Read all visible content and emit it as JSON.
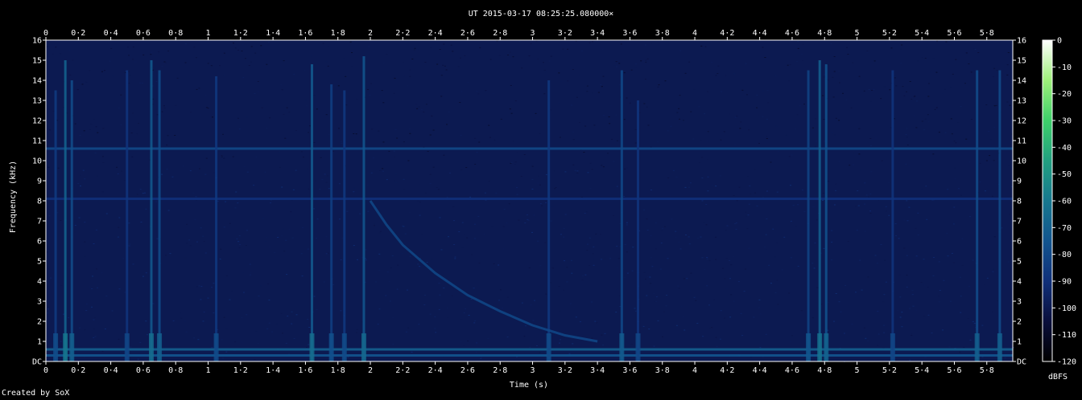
{
  "chart_data": {
    "type": "heatmap",
    "title": "UT 2015-03-17 08:25:25.080000×",
    "xlabel": "Time (s)",
    "ylabel": "Frequency (kHz)",
    "colorbar_label": "dBFS",
    "credit": "Created by SoX",
    "xlim": [
      0,
      5.96
    ],
    "ylim": [
      0,
      16
    ],
    "x_ticks": [
      {
        "v": 0,
        "label": "0"
      },
      {
        "v": 0.2,
        "label": "0·2"
      },
      {
        "v": 0.4,
        "label": "0·4"
      },
      {
        "v": 0.6,
        "label": "0·6"
      },
      {
        "v": 0.8,
        "label": "0·8"
      },
      {
        "v": 1,
        "label": "1"
      },
      {
        "v": 1.2,
        "label": "1·2"
      },
      {
        "v": 1.4,
        "label": "1·4"
      },
      {
        "v": 1.6,
        "label": "1·6"
      },
      {
        "v": 1.8,
        "label": "1·8"
      },
      {
        "v": 2,
        "label": "2"
      },
      {
        "v": 2.2,
        "label": "2·2"
      },
      {
        "v": 2.4,
        "label": "2·4"
      },
      {
        "v": 2.6,
        "label": "2·6"
      },
      {
        "v": 2.8,
        "label": "2·8"
      },
      {
        "v": 3,
        "label": "3"
      },
      {
        "v": 3.2,
        "label": "3·2"
      },
      {
        "v": 3.4,
        "label": "3·4"
      },
      {
        "v": 3.6,
        "label": "3·6"
      },
      {
        "v": 3.8,
        "label": "3·8"
      },
      {
        "v": 4,
        "label": "4"
      },
      {
        "v": 4.2,
        "label": "4·2"
      },
      {
        "v": 4.4,
        "label": "4·4"
      },
      {
        "v": 4.6,
        "label": "4·6"
      },
      {
        "v": 4.8,
        "label": "4·8"
      },
      {
        "v": 5,
        "label": "5"
      },
      {
        "v": 5.2,
        "label": "5·2"
      },
      {
        "v": 5.4,
        "label": "5·4"
      },
      {
        "v": 5.6,
        "label": "5·6"
      },
      {
        "v": 5.8,
        "label": "5·8"
      }
    ],
    "y_ticks": [
      {
        "v": 0,
        "label": "DC"
      },
      {
        "v": 1,
        "label": "1"
      },
      {
        "v": 2,
        "label": "2"
      },
      {
        "v": 3,
        "label": "3"
      },
      {
        "v": 4,
        "label": "4"
      },
      {
        "v": 5,
        "label": "5"
      },
      {
        "v": 6,
        "label": "6"
      },
      {
        "v": 7,
        "label": "7"
      },
      {
        "v": 8,
        "label": "8"
      },
      {
        "v": 9,
        "label": "9"
      },
      {
        "v": 10,
        "label": "10"
      },
      {
        "v": 11,
        "label": "11"
      },
      {
        "v": 12,
        "label": "12"
      },
      {
        "v": 13,
        "label": "13"
      },
      {
        "v": 14,
        "label": "14"
      },
      {
        "v": 15,
        "label": "15"
      },
      {
        "v": 16,
        "label": "16"
      }
    ],
    "colorbar": {
      "range": [
        -120,
        0
      ],
      "ticks": [
        0,
        -10,
        -20,
        -30,
        -40,
        -50,
        -60,
        -70,
        -80,
        -90,
        -100,
        -110,
        -120
      ],
      "tick_labels": [
        "0",
        "-10",
        "-20",
        "-30",
        "-40",
        "-50",
        "-60",
        "-70",
        "-80",
        "-90",
        "-100",
        "-110",
        "-120"
      ],
      "colors": [
        "#000000",
        "#0a0f3c",
        "#10307a",
        "#12558f",
        "#17788f",
        "#22a080",
        "#3ed06a",
        "#9ef07a",
        "#ffffff"
      ]
    },
    "background_level_dbfs": -100,
    "horizontal_lines": [
      {
        "freq_khz": 10.6,
        "level_dbfs": -80
      },
      {
        "freq_khz": 8.1,
        "level_dbfs": -90
      },
      {
        "freq_khz": 0.6,
        "level_dbfs": -70
      },
      {
        "freq_khz": 0.3,
        "level_dbfs": -75
      }
    ],
    "vertical_events": [
      {
        "t": 0.06,
        "fmax": 13.5,
        "level_dbfs": -85
      },
      {
        "t": 0.12,
        "fmax": 15.0,
        "level_dbfs": -68
      },
      {
        "t": 0.16,
        "fmax": 14.0,
        "level_dbfs": -78
      },
      {
        "t": 0.5,
        "fmax": 14.5,
        "level_dbfs": -88
      },
      {
        "t": 0.65,
        "fmax": 15.0,
        "level_dbfs": -72
      },
      {
        "t": 0.7,
        "fmax": 14.5,
        "level_dbfs": -78
      },
      {
        "t": 1.05,
        "fmax": 14.2,
        "level_dbfs": -86
      },
      {
        "t": 1.64,
        "fmax": 14.8,
        "level_dbfs": -72
      },
      {
        "t": 1.76,
        "fmax": 13.8,
        "level_dbfs": -84
      },
      {
        "t": 1.84,
        "fmax": 13.5,
        "level_dbfs": -86
      },
      {
        "t": 1.96,
        "fmax": 15.2,
        "level_dbfs": -74
      },
      {
        "t": 3.1,
        "fmax": 14.0,
        "level_dbfs": -86
      },
      {
        "t": 3.55,
        "fmax": 14.5,
        "level_dbfs": -80
      },
      {
        "t": 3.65,
        "fmax": 13.0,
        "level_dbfs": -88
      },
      {
        "t": 4.7,
        "fmax": 14.5,
        "level_dbfs": -82
      },
      {
        "t": 4.77,
        "fmax": 15.0,
        "level_dbfs": -70
      },
      {
        "t": 4.81,
        "fmax": 14.8,
        "level_dbfs": -76
      },
      {
        "t": 5.22,
        "fmax": 14.5,
        "level_dbfs": -88
      },
      {
        "t": 5.74,
        "fmax": 14.5,
        "level_dbfs": -78
      },
      {
        "t": 5.88,
        "fmax": 14.5,
        "level_dbfs": -78
      }
    ],
    "sweep": {
      "description": "descending tone",
      "t": [
        2.0,
        2.1,
        2.2,
        2.4,
        2.6,
        2.8,
        3.0,
        3.2,
        3.4
      ],
      "freq_khz": [
        8.0,
        6.8,
        5.8,
        4.4,
        3.3,
        2.5,
        1.8,
        1.3,
        1.0
      ],
      "level_dbfs": -80
    }
  }
}
